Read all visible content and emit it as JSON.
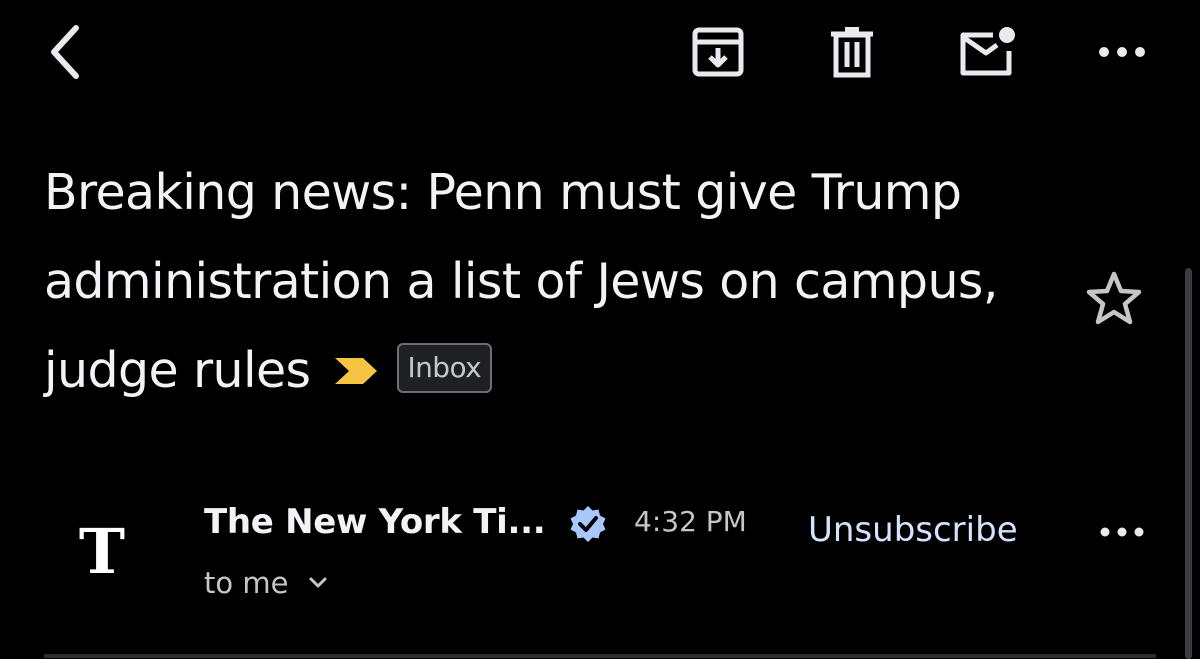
{
  "toolbar": {
    "back_icon": "chevron-left-icon",
    "archive_icon": "archive-icon",
    "delete_icon": "trash-icon",
    "mark_unread_icon": "mail-unread-icon",
    "more_icon": "more-horizontal-icon"
  },
  "email": {
    "subject": "Breaking news: Penn must give Trump administration a list of Jews on campus, judge rules",
    "importance_marker": "important-arrow-icon",
    "importance_color": "#f6c343",
    "label": "Inbox",
    "starred": false,
    "sender": {
      "avatar_letter": "T",
      "name": "The New York Ti...",
      "verified": true,
      "time": "4:32 PM",
      "unsubscribe_label": "Unsubscribe",
      "recipient_summary": "to me"
    }
  },
  "colors": {
    "background": "#000000",
    "text_primary": "#f1f3f4",
    "text_secondary": "#c4c7c5",
    "link": "#d6e3ff",
    "verified_badge": "#a8c7fa"
  }
}
